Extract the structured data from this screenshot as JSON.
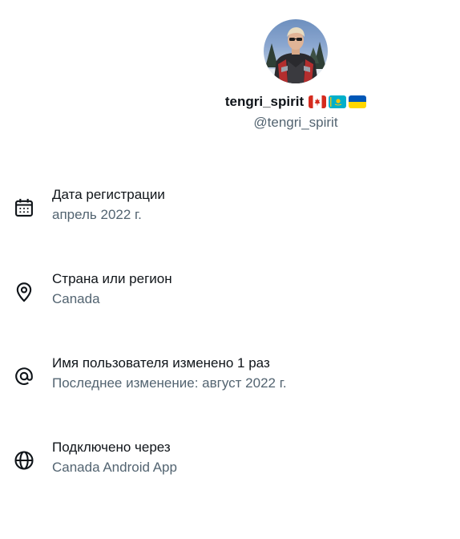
{
  "profile": {
    "display_name": "tengri_spirit",
    "flags": [
      "canada-flag-icon",
      "kazakhstan-flag-icon",
      "ukraine-flag-icon"
    ],
    "handle": "@tengri_spirit"
  },
  "about": [
    {
      "icon": "calendar-icon",
      "title": "Дата регистрации",
      "value": "апрель 2022 г."
    },
    {
      "icon": "location-pin-icon",
      "title": "Страна или регион",
      "value": "Canada"
    },
    {
      "icon": "at-sign-icon",
      "title": "Имя пользователя изменено 1 раз",
      "value": "Последнее изменение: август 2022 г."
    },
    {
      "icon": "globe-icon",
      "title": "Подключено через",
      "value": "Canada Android App"
    }
  ],
  "colors": {
    "text_primary": "#0f1419",
    "text_secondary": "#536471"
  }
}
